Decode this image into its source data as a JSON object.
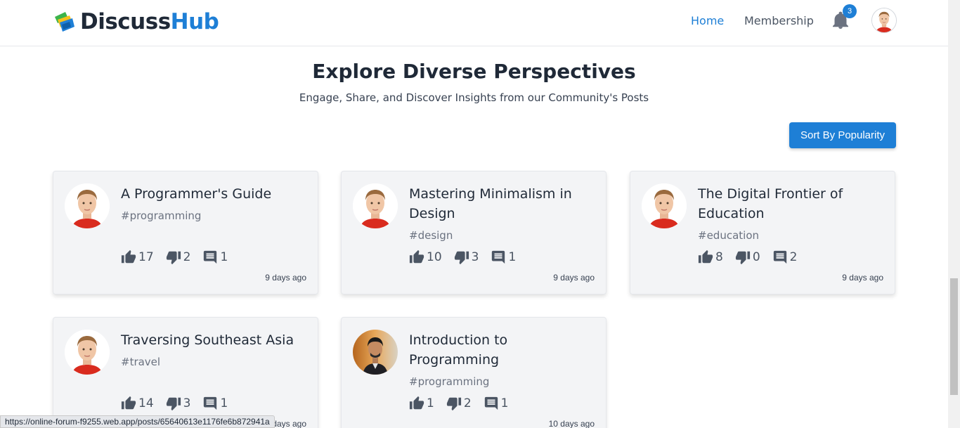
{
  "brand": {
    "name_part1": "Discuss",
    "name_part2": "Hub",
    "accent_color": "#1e7fd6"
  },
  "nav": {
    "home_label": "Home",
    "membership_label": "Membership",
    "notifications_count": "3",
    "bell_icon": "bell-icon"
  },
  "hero": {
    "title": "Explore Diverse Perspectives",
    "subtitle": "Engage, Share, and Discover Insights from our Community's Posts"
  },
  "sort_button_label": "Sort By Popularity",
  "posts": [
    {
      "title": "A Programmer's Guide",
      "tag": "#programming",
      "upvotes": "17",
      "downvotes": "2",
      "comments": "1",
      "date": "9 days ago",
      "avatar": "boy-avatar"
    },
    {
      "title": "Mastering Minimalism in Design",
      "tag": "#design",
      "upvotes": "10",
      "downvotes": "3",
      "comments": "1",
      "date": "9 days ago",
      "avatar": "boy-avatar"
    },
    {
      "title": "The Digital Frontier of Education",
      "tag": "#education",
      "upvotes": "8",
      "downvotes": "0",
      "comments": "2",
      "date": "9 days ago",
      "avatar": "boy-avatar"
    },
    {
      "title": "Traversing Southeast Asia",
      "tag": "#travel",
      "upvotes": "14",
      "downvotes": "3",
      "comments": "1",
      "date": "9 days ago",
      "avatar": "boy-avatar"
    },
    {
      "title": "Introduction to Programming",
      "tag": "#programming",
      "upvotes": "1",
      "downvotes": "2",
      "comments": "1",
      "date": "10 days ago",
      "avatar": "man-photo-avatar"
    }
  ],
  "status_bar_url": "https://online-forum-f9255.web.app/posts/65640613e1176fe6b872941a"
}
